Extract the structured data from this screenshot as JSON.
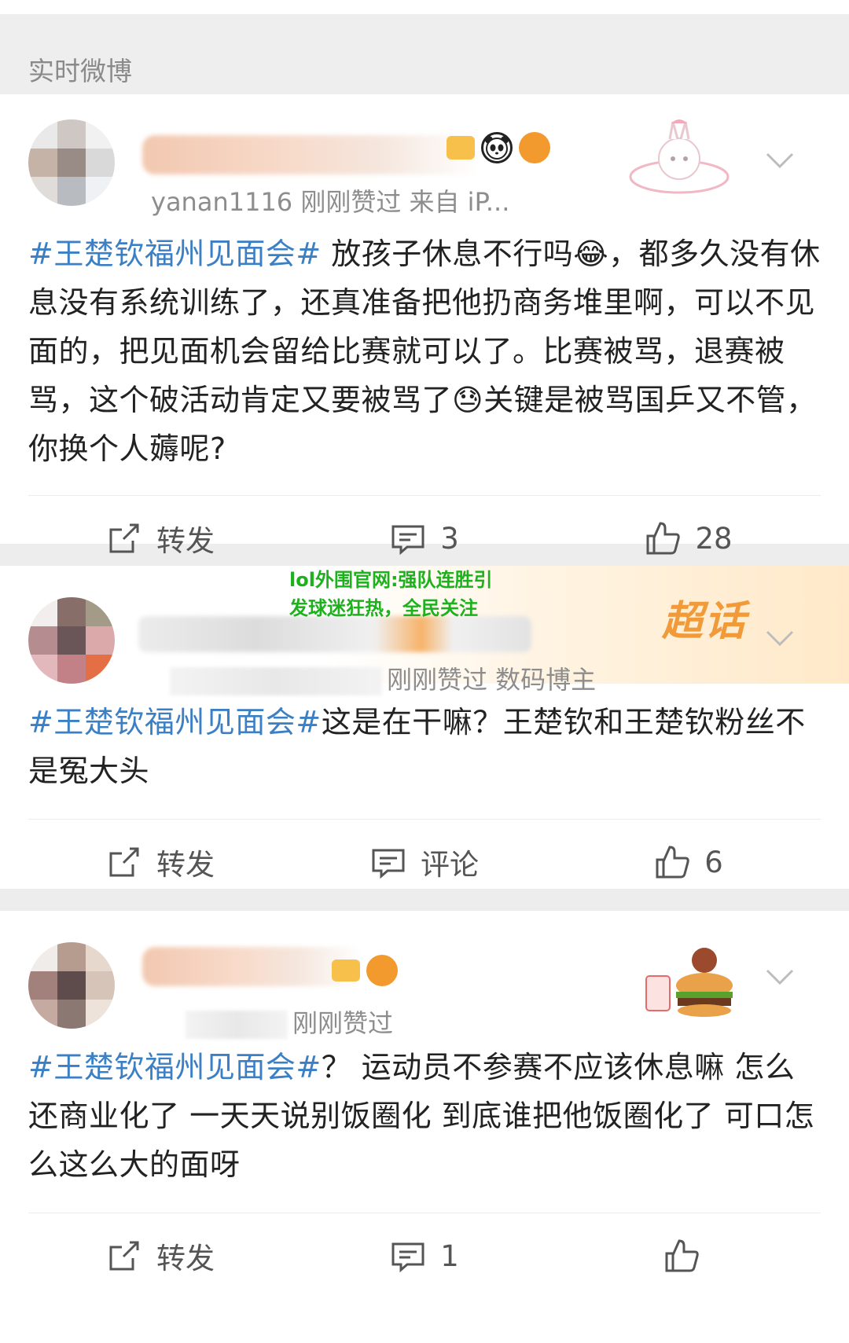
{
  "header": {
    "title": "实时微博"
  },
  "posts": [
    {
      "meta": "yanan1116 刚刚赞过  来自 iP...",
      "topic": "#王楚钦福州见面会#",
      "text": " 放孩子休息不行吗😂，都多久没有休息没有系统训练了，还真准备把他扔商务堆里啊，可以不见面的，把见面机会留给比赛就可以了。比赛被骂，退赛被骂，这个破活动肯定又要被骂了😓关键是被骂国乒又不管，你换个人薅呢?",
      "actions": {
        "repost": "转发",
        "comment": "3",
        "like": "28"
      }
    },
    {
      "meta": "刚刚赞过   数码博主",
      "supertopic": "超话",
      "topic": "#王楚钦福州见面会#",
      "text": "这是在干嘛？王楚钦和王楚钦粉丝不是冤大头",
      "actions": {
        "repost": "转发",
        "comment": "评论",
        "like": "6"
      }
    },
    {
      "meta": "刚刚赞过",
      "topic": "#王楚钦福州见面会#",
      "text": "？ 运动员不参赛不应该休息嘛 怎么还商业化了 一天天说别饭圈化 到底谁把他饭圈化了 可口怎么这么大的面呀",
      "actions": {
        "repost": "转发",
        "comment": "1",
        "like": ""
      }
    }
  ],
  "overlay": {
    "text": "lol外围官网:强队连胜引发球迷狂热，全民关注"
  },
  "colors": {
    "topic": "#3b7fc4",
    "overlay": "#1db11d",
    "supertopic": "#f19a3a"
  }
}
